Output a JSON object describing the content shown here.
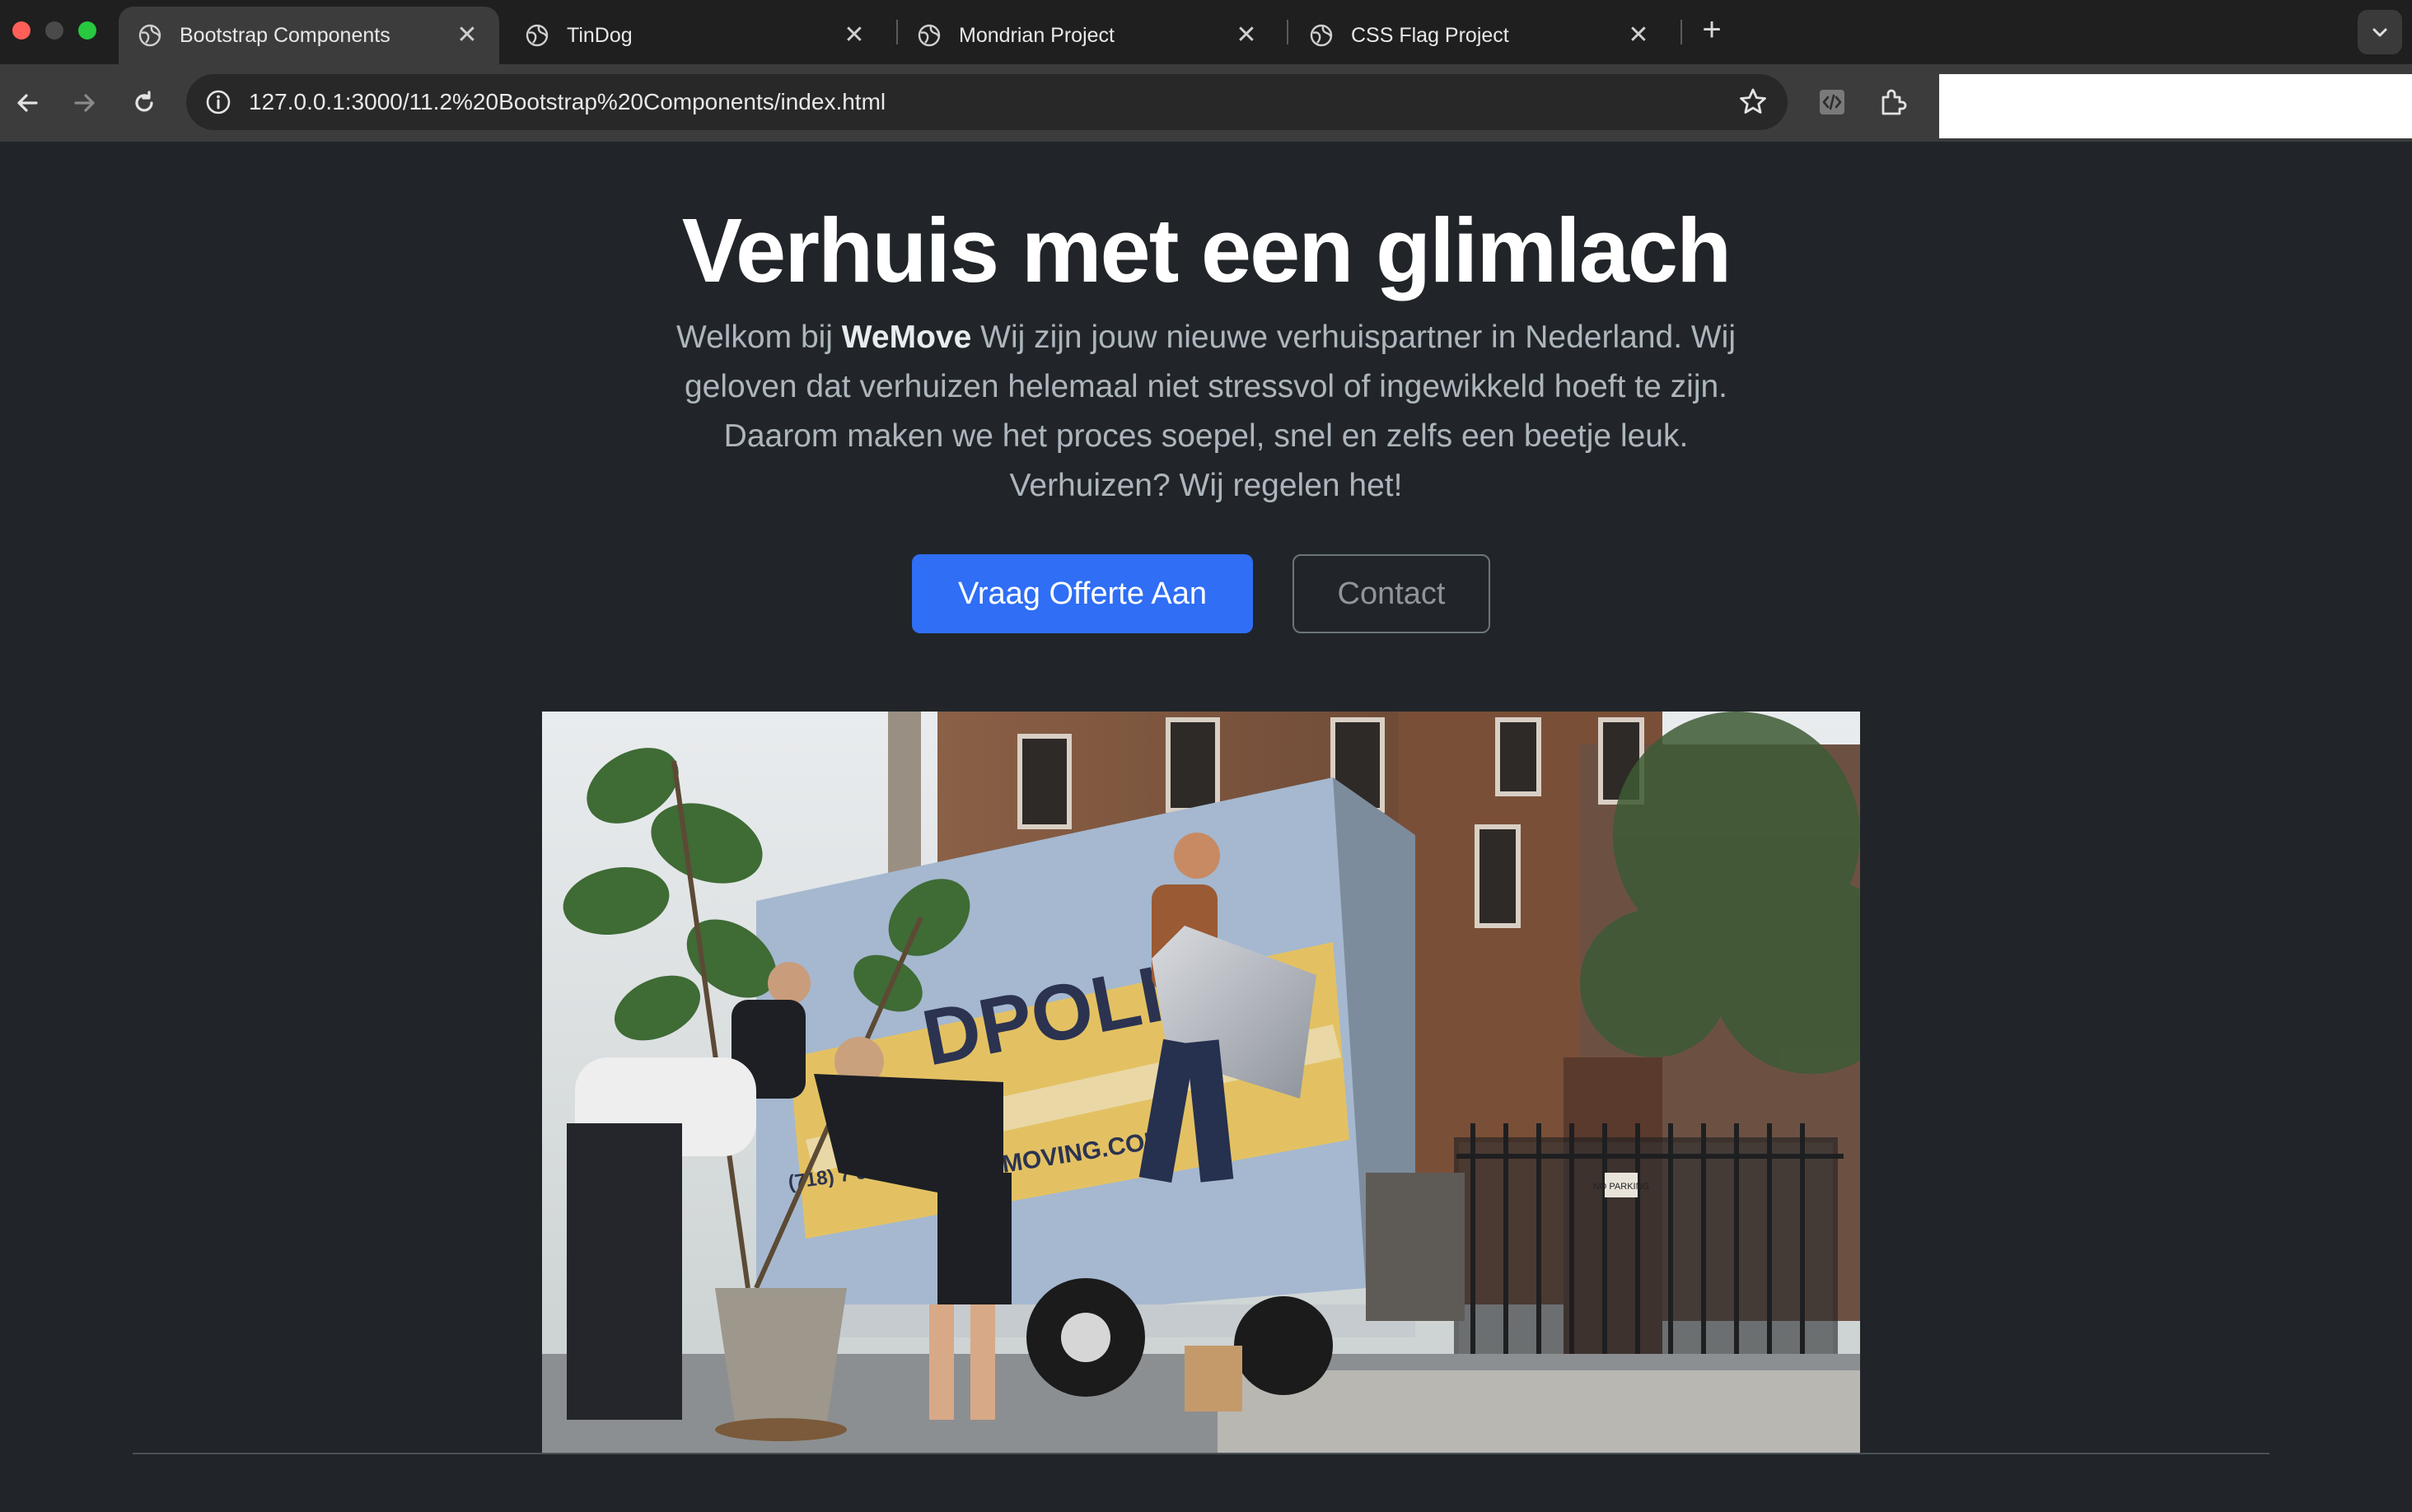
{
  "browser": {
    "tabs": [
      {
        "title": "Bootstrap Components",
        "active": true
      },
      {
        "title": "TinDog",
        "active": false
      },
      {
        "title": "Mondrian Project",
        "active": false
      },
      {
        "title": "CSS Flag Project",
        "active": false
      }
    ],
    "new_tab_label": "+",
    "close_glyph": "✕",
    "address_bar": {
      "url": "127.0.0.1:3000/11.2%20Bootstrap%20Components/index.html"
    }
  },
  "icons": {
    "tab_favicon": "globe-icon",
    "back": "arrow-left-icon",
    "forward": "arrow-right-icon",
    "reload": "reload-icon",
    "site_info": "info-icon",
    "bookmark": "star-icon",
    "devtools_extension": "code-extension-icon",
    "extensions": "puzzle-icon",
    "tab_search": "chevron-down-icon"
  },
  "hero": {
    "title": "Verhuis met een glimlach",
    "lead_prefix": "Welkom bij ",
    "lead_brand": "WeMove",
    "lead_rest": " Wij zijn jouw nieuwe verhuispartner in Nederland. Wij geloven dat verhuizen helemaal niet stressvol of ingewikkeld hoeft te zijn. Daarom maken we het proces soepel, snel en zelfs een beetje leuk. Verhuizen? Wij regelen het!",
    "primary_button": "Vraag Offerte Aan",
    "secondary_button": "Contact"
  },
  "photo": {
    "truck_text_1": "DPOLIS",
    "truck_text_2": "MOVING.COM",
    "truck_text_3": "(718) 7  520 •",
    "sign_text": "NO PARKING"
  },
  "colors": {
    "page_bg": "#212529",
    "primary": "#2f6ef5",
    "outline": "#6c757d",
    "muted_text": "#adb5bd"
  }
}
